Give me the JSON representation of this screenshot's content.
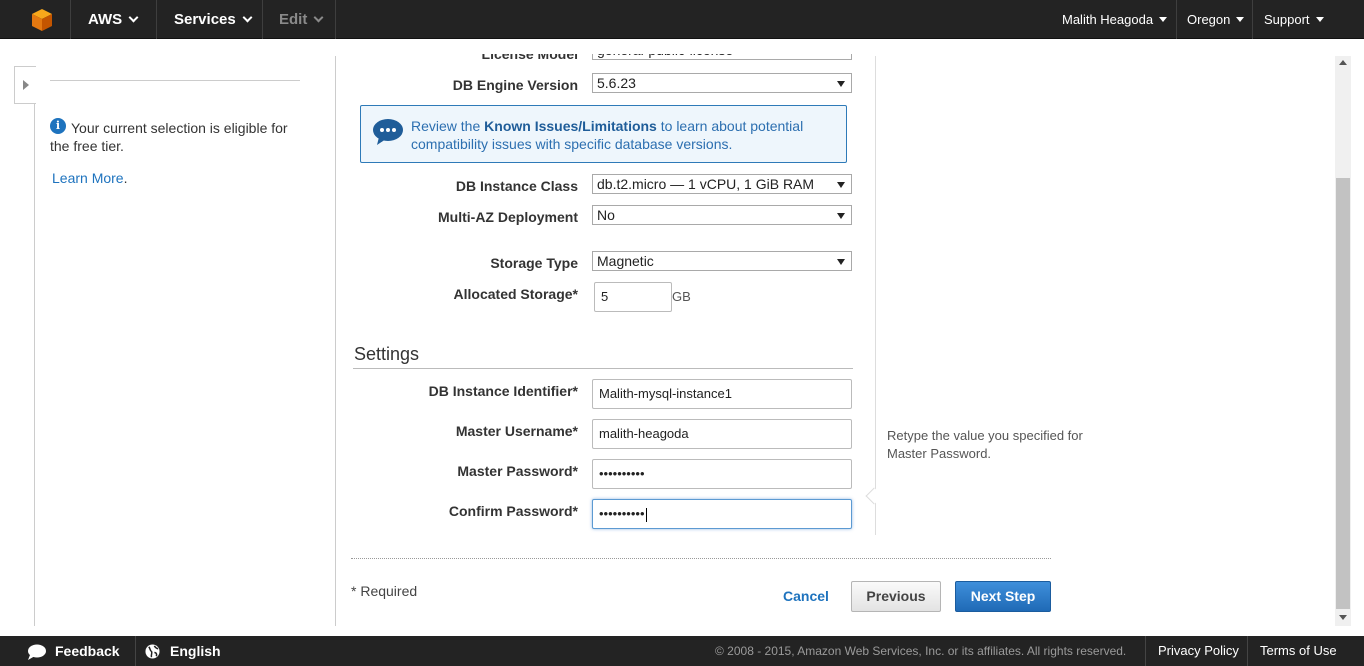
{
  "topnav": {
    "brand": "AWS",
    "services": "Services",
    "edit": "Edit",
    "user": "Malith Heagoda",
    "region": "Oregon",
    "support": "Support"
  },
  "sidebar": {
    "free_tier_text": "Your current selection is eligible for the free tier.",
    "learn_more": "Learn More",
    "learn_more_suffix": "."
  },
  "form": {
    "license_model_label": "License Model",
    "license_model_value": "general-public-license",
    "engine_version_label": "DB Engine Version",
    "engine_version_value": "5.6.23",
    "notice": {
      "prefix": "Review the ",
      "link": "Known Issues/Limitations",
      "suffix": " to learn about potential compatibility issues with specific database versions."
    },
    "instance_class_label": "DB Instance Class",
    "instance_class_value": "db.t2.micro — 1 vCPU, 1 GiB RAM",
    "multi_az_label": "Multi-AZ Deployment",
    "multi_az_value": "No",
    "storage_type_label": "Storage Type",
    "storage_type_value": "Magnetic",
    "allocated_storage_label": "Allocated Storage*",
    "allocated_storage_value": "5",
    "allocated_storage_unit": "GB",
    "settings_title": "Settings",
    "identifier_label": "DB Instance Identifier*",
    "identifier_value": "Malith-mysql-instance1",
    "username_label": "Master Username*",
    "username_value": "malith-heagoda",
    "password_label": "Master Password*",
    "password_value": "••••••••••",
    "confirm_label": "Confirm Password*",
    "confirm_value": "••••••••••",
    "confirm_help": "Retype the value you specified for Master Password."
  },
  "actions": {
    "required_note": "* Required",
    "cancel": "Cancel",
    "previous": "Previous",
    "next": "Next Step"
  },
  "footer": {
    "feedback": "Feedback",
    "language": "English",
    "copyright": "© 2008 - 2015, Amazon Web Services, Inc. or its affiliates. All rights reserved.",
    "privacy": "Privacy Policy",
    "terms": "Terms of Use"
  },
  "colors": {
    "nav_bg": "#232323",
    "link_blue": "#1e73be",
    "primary_button": "#1f6ab6"
  }
}
